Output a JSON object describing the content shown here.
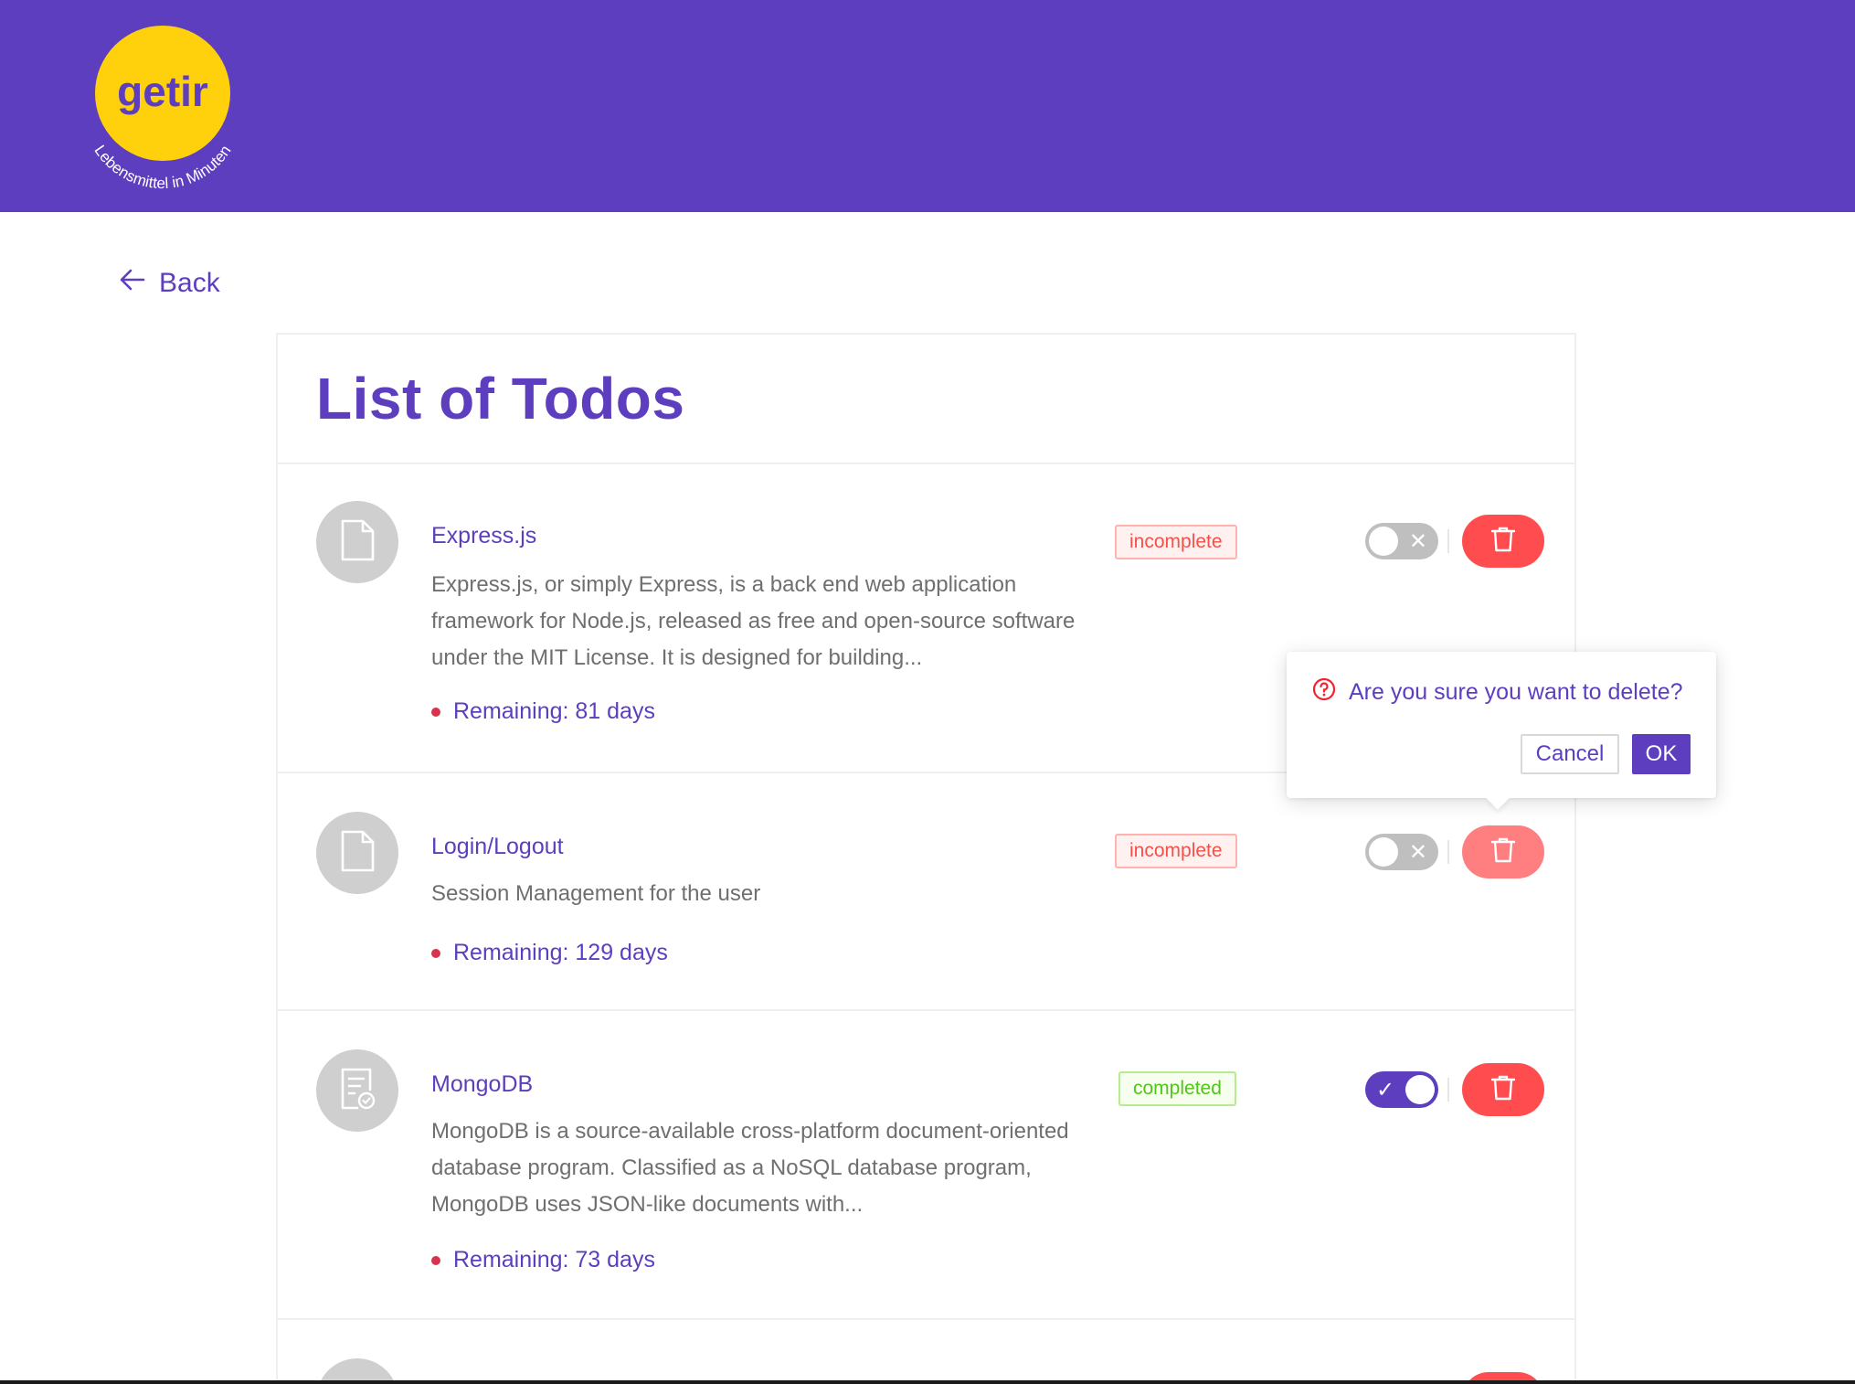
{
  "header": {
    "logo_text": "getir",
    "logo_tagline": "Lebensmittel in Minuten",
    "colors": {
      "brand": "#5d3ebe",
      "logo_yellow": "#ffd10d"
    }
  },
  "nav": {
    "back_label": "Back",
    "back_icon": "arrow-left-icon"
  },
  "card": {
    "title": "List of Todos"
  },
  "todos": [
    {
      "title": "Express.js",
      "description": "Express.js, or simply Express, is a back end web application framework for Node.js, released as free and open-source software under the MIT License. It is designed for building...",
      "remaining": "Remaining: 81 days",
      "status": "incomplete",
      "completed": false,
      "icon": "file-icon"
    },
    {
      "title": "Login/Logout",
      "description": "Session Management for the user",
      "remaining": "Remaining: 129 days",
      "status": "incomplete",
      "completed": false,
      "icon": "file-icon"
    },
    {
      "title": "MongoDB",
      "description": "MongoDB is a source-available cross-platform document-oriented database program. Classified as a NoSQL database program, MongoDB uses JSON-like documents with...",
      "remaining": "Remaining: 73 days",
      "status": "completed",
      "completed": true,
      "icon": "file-done-icon"
    }
  ],
  "toggle_marks": {
    "off": "✕",
    "on": "✓"
  },
  "popconfirm": {
    "message": "Are you sure you want to delete?",
    "cancel_label": "Cancel",
    "ok_label": "OK",
    "icon": "question-circle-icon"
  }
}
